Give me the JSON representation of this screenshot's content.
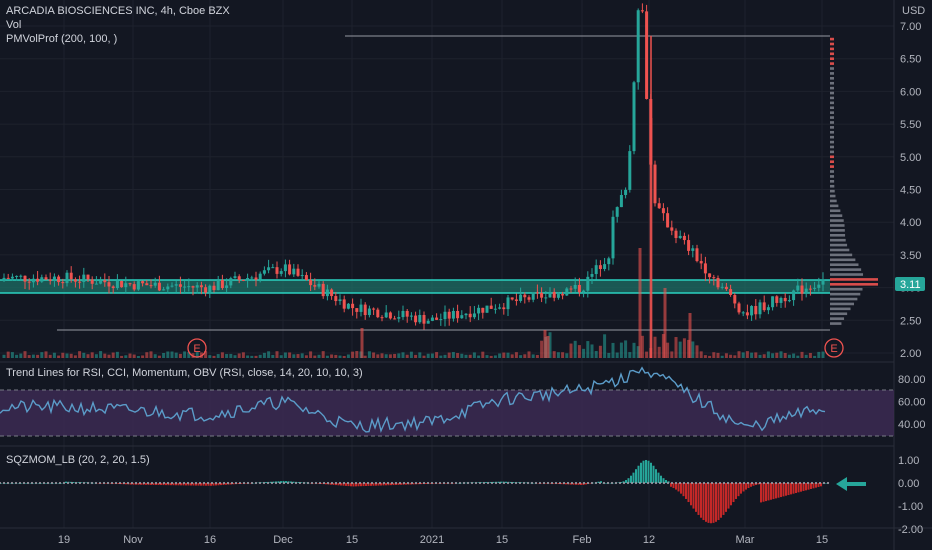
{
  "header": {
    "symbol": "ARCADIA BIOSCIENCES INC, 4h, Cboe BZX",
    "vol": "Vol",
    "pmvol": "PMVolProf (200, 100, )"
  },
  "indicators": {
    "trend": "Trend Lines for RSI, CCI, Momentum, OBV (RSI, close, 14, 20, 10, 10, 3)",
    "sqz": "SQZMOM_LB (20, 2, 20, 1.5)"
  },
  "price_axis": {
    "currency": "USD",
    "ticks": [
      "7.00",
      "6.50",
      "6.00",
      "5.50",
      "5.00",
      "4.50",
      "4.00",
      "3.50",
      "3.00",
      "2.50",
      "2.00"
    ],
    "current_price": "3.11"
  },
  "rsi_axis": {
    "ticks": [
      "80.00",
      "60.00",
      "40.00"
    ]
  },
  "sqz_axis": {
    "ticks": [
      "1.00",
      "0.00",
      "-1.00",
      "-2.00"
    ]
  },
  "time_axis": {
    "ticks": [
      "19",
      "Nov",
      "16",
      "Dec",
      "15",
      "2021",
      "15",
      "Feb",
      "12",
      "Mar",
      "15"
    ]
  },
  "earnings_markers": [
    "E",
    "E"
  ],
  "colors": {
    "background": "#131722",
    "up": "#26a69a",
    "down": "#ef5350",
    "zone_fill": "#1d6f66",
    "zone_line": "#2ad1c0",
    "rsi_line": "#5b9cc9",
    "rsi_band": "#3c2a52",
    "sqz_up": "#26a69a",
    "sqz_down": "#c62828",
    "arrow": "#26a69a"
  },
  "chart_data": [
    {
      "type": "candlestick",
      "title": "ARCADIA BIOSCIENCES INC, 4h, Cboe BZX",
      "x": [
        "19",
        "Nov",
        "16",
        "Dec",
        "15",
        "2021",
        "15",
        "Feb",
        "12",
        "Mar",
        "15"
      ],
      "ylim": [
        2.0,
        7.0
      ],
      "support_zone": [
        2.93,
        3.14
      ],
      "resistance_line": 6.85,
      "support_line": 2.37,
      "close_key_points": [
        {
          "x": "19",
          "y": 3.15
        },
        {
          "x": "Nov",
          "y": 3.05
        },
        {
          "x": "16",
          "y": 3.0
        },
        {
          "x": "Dec",
          "y": 3.3
        },
        {
          "x": "15",
          "y": 2.7
        },
        {
          "x": "2021",
          "y": 2.5
        },
        {
          "x": "15",
          "y": 2.75
        },
        {
          "x": "Feb",
          "y": 3.0
        },
        {
          "x": "12",
          "y": 4.3
        },
        {
          "x": "Mar",
          "y": 2.6
        },
        {
          "x": "15",
          "y": 3.11
        }
      ],
      "peak": 6.85
    },
    {
      "type": "line",
      "title": "Trend Lines for RSI, CCI, Momentum, OBV (RSI, close, 14, 20, 10, 10, 3)",
      "ylim": [
        25,
        92
      ],
      "band": [
        30,
        70
      ],
      "points": [
        {
          "x": "19",
          "y": 55
        },
        {
          "x": "Nov",
          "y": 52
        },
        {
          "x": "16",
          "y": 48
        },
        {
          "x": "Dec",
          "y": 60
        },
        {
          "x": "15",
          "y": 38
        },
        {
          "x": "2021",
          "y": 42
        },
        {
          "x": "15",
          "y": 62
        },
        {
          "x": "Feb",
          "y": 70
        },
        {
          "x": "12",
          "y": 88
        },
        {
          "x": "Mar",
          "y": 36
        },
        {
          "x": "15",
          "y": 54
        }
      ]
    },
    {
      "type": "bar",
      "title": "SQZMOM_LB (20, 2, 20, 1.5)",
      "ylim": [
        -2.3,
        1.3
      ],
      "points": [
        {
          "x": "19",
          "y": 0.1
        },
        {
          "x": "Nov",
          "y": -0.12
        },
        {
          "x": "16",
          "y": -0.2
        },
        {
          "x": "Dec",
          "y": 0.15
        },
        {
          "x": "15",
          "y": -0.25
        },
        {
          "x": "2021",
          "y": -0.05
        },
        {
          "x": "15",
          "y": 0.1
        },
        {
          "x": "Feb",
          "y": -0.15
        },
        {
          "x": "12",
          "y": 0.9
        },
        {
          "x": "Mar",
          "y": -1.7
        },
        {
          "x": "15",
          "y": -0.2
        }
      ]
    }
  ]
}
